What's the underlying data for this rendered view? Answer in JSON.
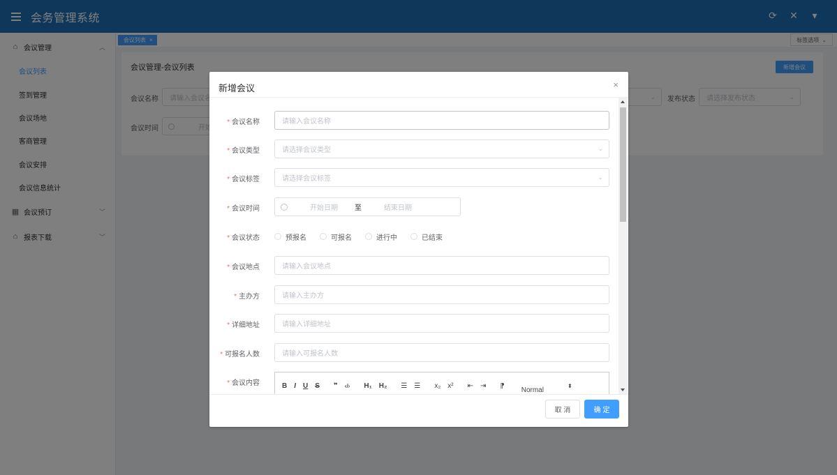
{
  "header": {
    "title": "会务管理系统",
    "icons": [
      "menu-icon",
      "refresh-icon",
      "fullscreen-icon",
      "caret-down-icon"
    ]
  },
  "sidebar": {
    "groups": [
      {
        "label": "会议管理",
        "icon": "home-icon",
        "expanded": true,
        "items": [
          "会议列表",
          "签到管理",
          "会议场地",
          "客商管理",
          "会议安排",
          "会议信息统计"
        ]
      },
      {
        "label": "会议预订",
        "icon": "grid-icon",
        "expanded": false
      },
      {
        "label": "报表下载",
        "icon": "home-icon",
        "expanded": false
      }
    ],
    "active_item": "会议列表"
  },
  "tabs": {
    "items": [
      {
        "label": "会议列表",
        "close": "×"
      }
    ],
    "options_label": "标签选项"
  },
  "card": {
    "title": "会议管理-会议列表",
    "add_button": "新增会议",
    "filters": {
      "name_label": "会议名称",
      "name_placeholder": "请输入会议名",
      "status_label": "发布状态",
      "status_placeholder": "请选择发布状态",
      "time_label": "会议时间",
      "time_placeholder": "开始"
    }
  },
  "dialog": {
    "title": "新增会议",
    "close": "×",
    "fields": {
      "name": {
        "label": "会议名称",
        "placeholder": "请输入会议名称"
      },
      "type": {
        "label": "会议类型",
        "placeholder": "请选择会议类型"
      },
      "tag": {
        "label": "会议标签",
        "placeholder": "请选择会议标签"
      },
      "time": {
        "label": "会议时间",
        "start": "开始日期",
        "separator": "至",
        "end": "结束日期"
      },
      "status": {
        "label": "会议状态",
        "options": [
          "预报名",
          "可报名",
          "进行中",
          "已结束"
        ]
      },
      "location": {
        "label": "会议地点",
        "placeholder": "请输入会议地点"
      },
      "host": {
        "label": "主办方",
        "placeholder": "请输入主办方"
      },
      "address": {
        "label": "详细地址",
        "placeholder": "请输入详细地址"
      },
      "capacity": {
        "label": "可报名人数",
        "placeholder": "请输入可报名人数"
      },
      "content": {
        "label": "会议内容"
      }
    },
    "editor_toolbar": {
      "bold": "B",
      "italic": "I",
      "underline": "U",
      "strike": "S",
      "quote": "❞",
      "code": "‹/›",
      "h1": "H₁",
      "h2": "H₂",
      "ordered": "☰",
      "bullet": "☰",
      "sub": "x₂",
      "sup": "x²",
      "outdent": "⇤",
      "indent": "⇥",
      "direction": "⁋",
      "size": "Normal",
      "size_arrow": "⬍"
    },
    "footer": {
      "cancel": "取 消",
      "confirm": "确 定"
    }
  }
}
